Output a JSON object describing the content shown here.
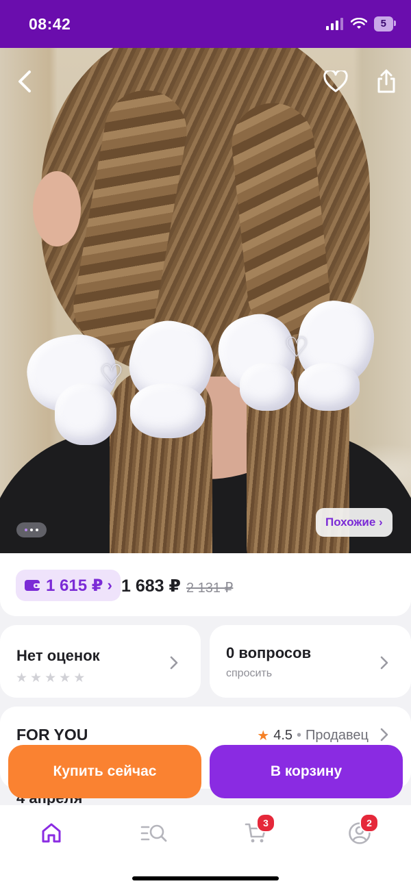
{
  "status_bar": {
    "time": "08:42",
    "battery": "5"
  },
  "gallery": {
    "similar_label": "Похожие ›"
  },
  "price": {
    "wallet_price": "1 615 ₽",
    "wallet_chevron": "›",
    "price": "1 683 ₽",
    "old_price": "2 131 ₽"
  },
  "ratings": {
    "title": "Нет оценок",
    "stars": [
      "★",
      "★",
      "★",
      "★",
      "★"
    ]
  },
  "questions": {
    "title": "0 вопросов",
    "subtitle": "спросить"
  },
  "seller": {
    "name": "FOR YOU",
    "rating": "4.5",
    "label": "Продавец"
  },
  "delivery": {
    "date": "4 апреля"
  },
  "actions": {
    "buy_now": "Купить сейчас",
    "add_to_cart": "В корзину"
  },
  "tabbar": {
    "cart_badge": "3",
    "profile_badge": "2"
  },
  "colors": {
    "brand": "#6a0dad",
    "accent": "#8a2be2",
    "buy": "#fa8231",
    "badge": "#e5283a"
  },
  "icons": [
    "back-icon",
    "heart-icon",
    "share-icon",
    "wallet-icon",
    "star-icon",
    "chevron-right-icon",
    "home-icon",
    "catalog-search-icon",
    "cart-icon",
    "profile-icon"
  ]
}
